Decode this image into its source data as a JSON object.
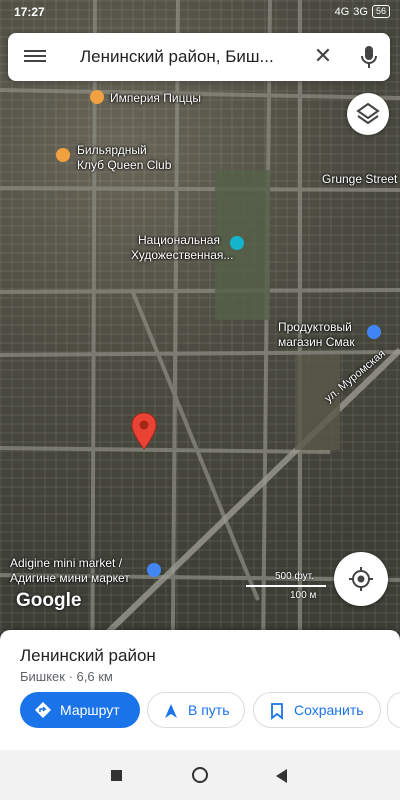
{
  "status": {
    "time": "17:27",
    "signal1": "4G",
    "signal2": "3G",
    "battery": "56"
  },
  "search": {
    "query": "Ленинский район, Биш...",
    "menu_icon": "menu-icon",
    "close_icon": "close-icon",
    "mic_icon": "mic-icon"
  },
  "map": {
    "labels": {
      "pizza": "Империя Пиццы",
      "billiard_1": "Бильярдный",
      "billiard_2": "Клуб Queen Club",
      "grunge": "Grunge Street",
      "gallery_1": "Национальная",
      "gallery_2": "Художественная...",
      "food_1": "Продуктовый",
      "food_2": "магазин Смак",
      "street": "ул. Муромская",
      "market_1": "Adigine mini market /",
      "market_2": "Адигине мини маркет"
    },
    "scale": {
      "feet": "500 фут.",
      "meters": "100 м"
    },
    "brand": "Google",
    "colors": {
      "food_poi": "#f2a140",
      "gallery_poi": "#12b5cb",
      "shop_poi": "#4285f4",
      "pin": "#ea4335"
    }
  },
  "place": {
    "title": "Ленинский район",
    "subtitle": "Бишкек · 6,6 км"
  },
  "actions": {
    "route": "Маршрут",
    "start": "В путь",
    "save": "Сохранить"
  }
}
